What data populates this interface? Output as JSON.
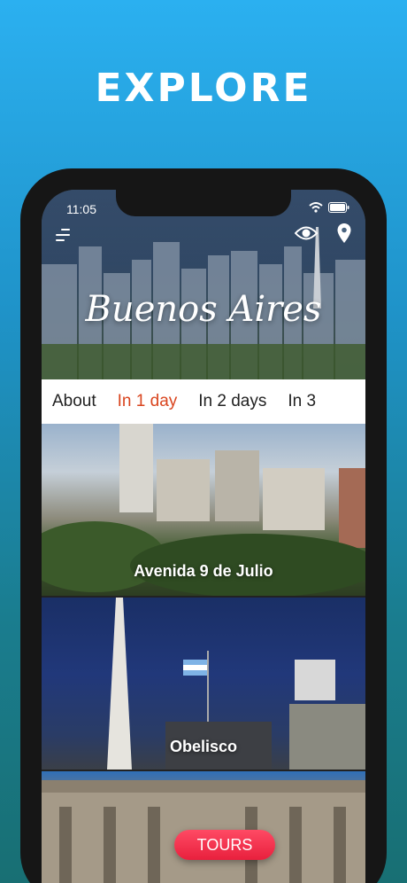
{
  "headline": "EXPLORE",
  "status_bar": {
    "time": "11:05"
  },
  "hero": {
    "city_title": "Buenos Aires"
  },
  "tabs": [
    {
      "label": "About",
      "active": false
    },
    {
      "label": "In 1 day",
      "active": true
    },
    {
      "label": "In 2 days",
      "active": false
    },
    {
      "label": "In 3",
      "active": false
    }
  ],
  "cards": [
    {
      "label": "Avenida 9 de Julio"
    },
    {
      "label": "Obelisco"
    },
    {
      "label": ""
    }
  ],
  "tours_button": {
    "label": "TOURS"
  },
  "colors": {
    "accent": "#d9451f",
    "tours": "#f0304c",
    "bg_top": "#2bb0f0",
    "bg_bottom": "#186f73"
  }
}
